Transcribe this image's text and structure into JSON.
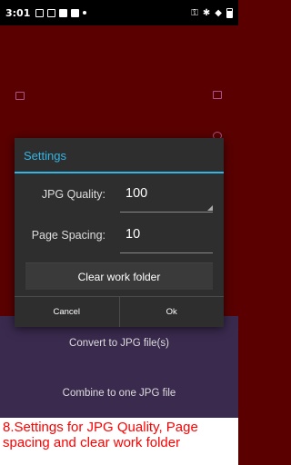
{
  "status_bar": {
    "time": "3:01"
  },
  "background": {
    "convert_label": "Convert to JPG file(s)",
    "combine_label": "Combine to one JPG file"
  },
  "dialog": {
    "title": "Settings",
    "jpg_quality_label": "JPG Quality:",
    "jpg_quality_value": "100",
    "page_spacing_label": "Page Spacing:",
    "page_spacing_value": "10",
    "clear_button": "Clear work folder",
    "cancel_button": "Cancel",
    "ok_button": "Ok"
  },
  "caption": "8.Settings for JPG Quality, Page spacing and clear work folder",
  "colors": {
    "accent": "#33b5e5",
    "caption_text": "#ff0000"
  }
}
